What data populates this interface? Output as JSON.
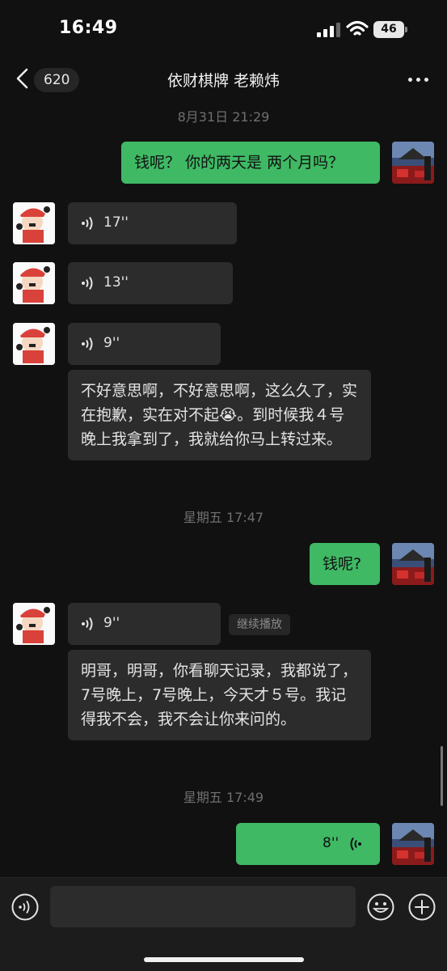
{
  "status": {
    "time": "16:49",
    "battery": "46"
  },
  "nav": {
    "unread_count": "620",
    "title": "依财棋牌 老赖炜"
  },
  "messages": {
    "ts1": "8月31日 21:29",
    "m1": "钱呢？ 你的两天是 两个月吗？",
    "v1": "17''",
    "v2": "13''",
    "v3": "9''",
    "t1": "不好意思啊，不好意思啊，这么久了，实在抱歉，实在对不起😭。到时候我４号晚上我拿到了，我就给你马上转过来。",
    "ts2": "星期五 17:47",
    "m2": "钱呢?",
    "v4": "9''",
    "continue_label": "继续播放",
    "t2": "明哥，明哥，你看聊天记录，我都说了，7号晚上，7号晚上，今天才５号。我记得我不会，我不会让你来问的。",
    "ts3": "星期五 17:49",
    "v5": "8''"
  },
  "colors": {
    "sent_bubble": "#3fb964",
    "received_bubble": "#2c2c2c",
    "background": "#111111"
  },
  "icons": [
    "back-chevron-icon",
    "more-icon",
    "voice-wave-icon",
    "emoji-icon",
    "plus-icon",
    "voice-input-icon"
  ]
}
